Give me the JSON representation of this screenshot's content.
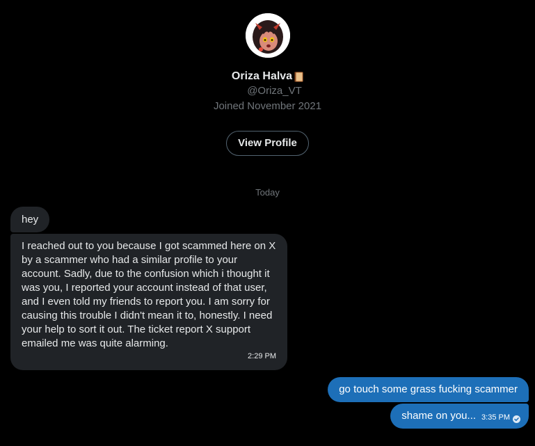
{
  "profile": {
    "name": "Oriza Halva",
    "name_emoji_icon": "book-icon",
    "handle": "@Oriza_VT",
    "joined": "Joined November 2021",
    "view_profile_label": "View Profile"
  },
  "conversation": {
    "day_label": "Today",
    "messages": [
      {
        "direction": "incoming",
        "text": "hey"
      },
      {
        "direction": "incoming",
        "text": "I reached out to you because I got scammed here on X by a scammer who had a similar profile to your account. Sadly, due to the confusion which i thought it was you, I reported your account instead of that user, and I even told my friends to report you. I am sorry for causing this trouble I didn't mean it to, honestly. I need your help to sort it out. The ticket report X support emailed me was quite alarming.",
        "time": "2:29 PM"
      },
      {
        "direction": "outgoing",
        "text": "go touch some grass fucking scammer"
      },
      {
        "direction": "outgoing",
        "text": "shame on you...",
        "time": "3:35 PM",
        "status_icon": "check-circle-icon"
      }
    ]
  },
  "colors": {
    "background": "#000000",
    "incoming_bubble": "#202327",
    "outgoing_bubble": "#1d6fb8",
    "secondary_text": "#71767b",
    "primary_text": "#e7e9ea"
  }
}
